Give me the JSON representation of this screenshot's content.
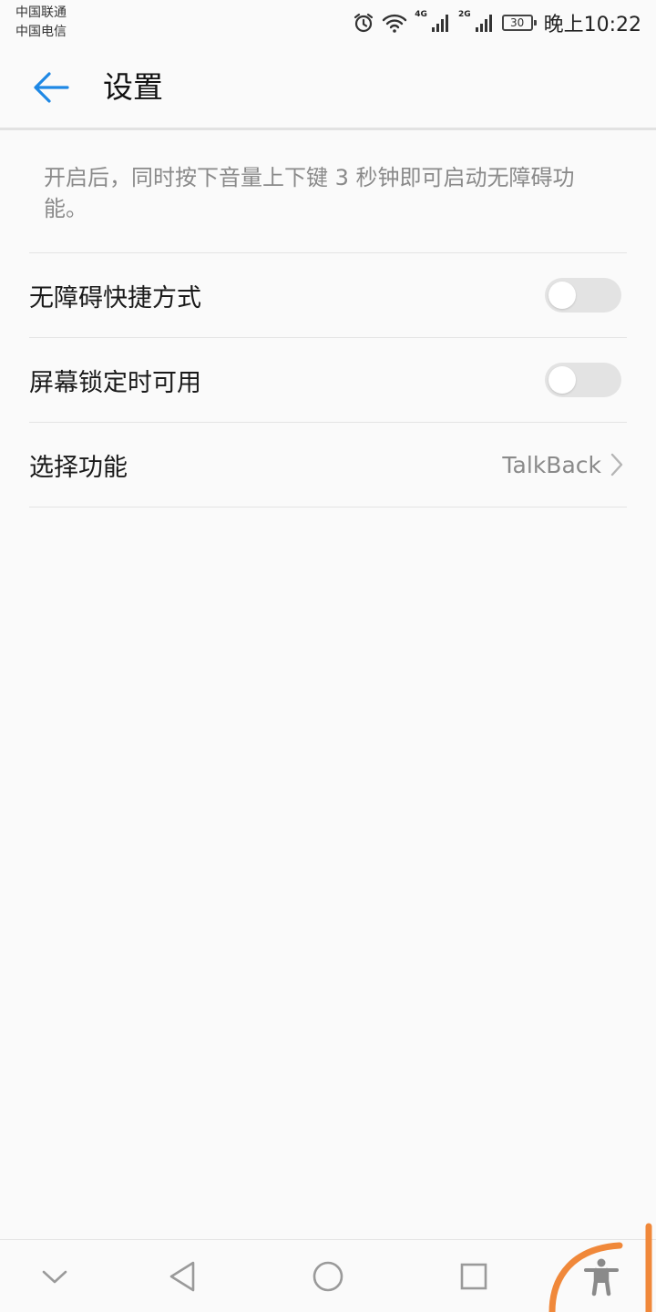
{
  "status_bar": {
    "carrier_1": "中国联通",
    "carrier_2": "中国电信",
    "net_1": "4G",
    "net_2": "2G",
    "battery": "30",
    "time": "晚上10:22",
    "icons": [
      "alarm-icon",
      "wifi-icon",
      "signal-icon",
      "signal-icon",
      "battery-icon"
    ]
  },
  "header": {
    "title": "设置",
    "back_icon": "back-arrow-icon",
    "accent_color": "#1e88e5"
  },
  "description": "开启后，同时按下音量上下键 3 秒钟即可启动无障碍功能。",
  "settings": {
    "items": [
      {
        "label": "无障碍快捷方式",
        "type": "toggle",
        "checked": false
      },
      {
        "label": "屏幕锁定时可用",
        "type": "toggle",
        "checked": false
      },
      {
        "label": "选择功能",
        "type": "link",
        "value": "TalkBack"
      }
    ]
  },
  "nav_bar": {
    "icons": [
      "collapse-chevron-icon",
      "back-triangle-icon",
      "home-circle-icon",
      "recents-square-icon",
      "accessibility-icon"
    ],
    "annotation_color": "#f0883a"
  }
}
